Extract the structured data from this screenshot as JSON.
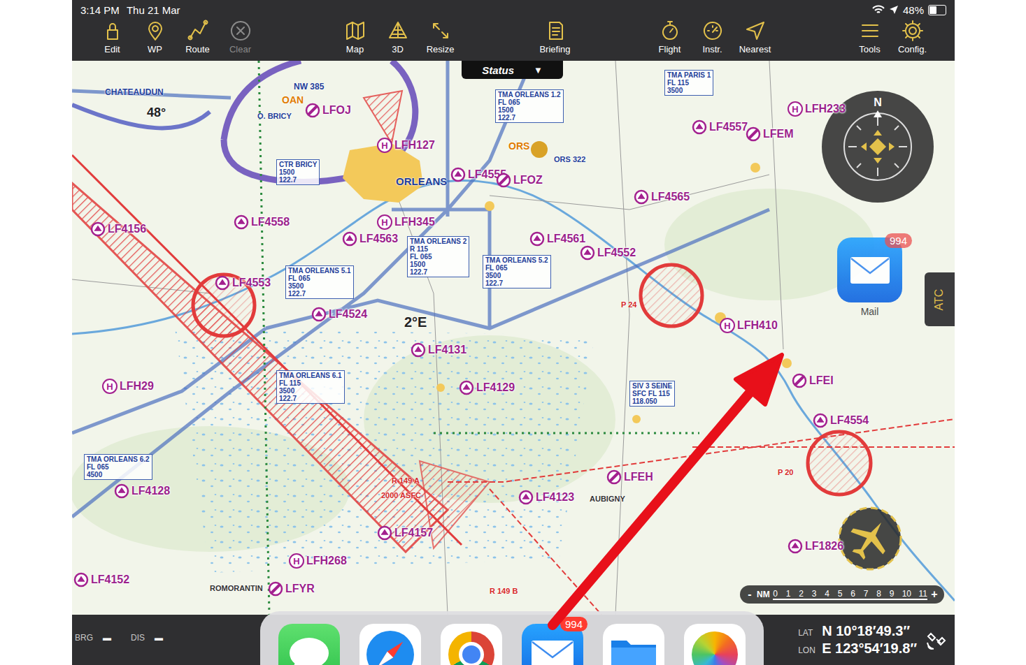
{
  "status_bar": {
    "time": "3:14 PM",
    "date": "Thu 21 Mar",
    "battery": "48%",
    "battery_level": 0.48
  },
  "toolbar": {
    "groups": [
      [
        {
          "label": "Edit",
          "disabled": false
        },
        {
          "label": "WP",
          "disabled": false
        },
        {
          "label": "Route",
          "disabled": false
        },
        {
          "label": "Clear",
          "disabled": true
        }
      ],
      [
        {
          "label": "Map",
          "disabled": false
        },
        {
          "label": "3D",
          "disabled": false
        },
        {
          "label": "Resize",
          "disabled": false
        }
      ],
      [
        {
          "label": "Briefing",
          "disabled": false
        }
      ],
      [
        {
          "label": "Flight",
          "disabled": false
        },
        {
          "label": "Instr.",
          "disabled": false
        },
        {
          "label": "Nearest",
          "disabled": false
        }
      ],
      [
        {
          "label": "Tools",
          "disabled": false
        },
        {
          "label": "Config.",
          "disabled": false
        }
      ]
    ]
  },
  "status_tab": {
    "label": "Status",
    "caret": "▼"
  },
  "map": {
    "airfields": [
      {
        "code": "LFH127",
        "kind": "heliport",
        "symbol": "H"
      },
      {
        "code": "LFOJ",
        "kind": "airport"
      },
      {
        "code": "LF4555",
        "kind": "airfield"
      },
      {
        "code": "LFOZ",
        "kind": "airport"
      },
      {
        "code": "LF4565",
        "kind": "airfield"
      },
      {
        "code": "LF4557",
        "kind": "airfield"
      },
      {
        "code": "LFEM",
        "kind": "airport"
      },
      {
        "code": "LFH233",
        "kind": "heliport",
        "symbol": "H"
      },
      {
        "code": "LF4156",
        "kind": "airfield"
      },
      {
        "code": "LF4558",
        "kind": "airfield"
      },
      {
        "code": "LFH345",
        "kind": "heliport",
        "symbol": "H"
      },
      {
        "code": "LF4563",
        "kind": "airfield"
      },
      {
        "code": "LF4561",
        "kind": "airfield"
      },
      {
        "code": "LF4552",
        "kind": "airfield"
      },
      {
        "code": "LF4553",
        "kind": "airfield"
      },
      {
        "code": "LF4524",
        "kind": "airfield"
      },
      {
        "code": "LFH410",
        "kind": "heliport",
        "symbol": "H"
      },
      {
        "code": "LF4131",
        "kind": "airfield"
      },
      {
        "code": "LF4129",
        "kind": "airfield"
      },
      {
        "code": "LFH29",
        "kind": "heliport",
        "symbol": "H"
      },
      {
        "code": "LFEI",
        "kind": "airport"
      },
      {
        "code": "LF4554",
        "kind": "airfield"
      },
      {
        "code": "LFEH",
        "kind": "airport"
      },
      {
        "code": "LF4128",
        "kind": "airfield"
      },
      {
        "code": "LF4123",
        "kind": "airfield"
      },
      {
        "code": "LF4157",
        "kind": "airfield"
      },
      {
        "code": "LFH268",
        "kind": "heliport",
        "symbol": "H"
      },
      {
        "code": "LF1826",
        "kind": "airfield"
      },
      {
        "code": "LF4152",
        "kind": "airfield"
      },
      {
        "code": "LFYR",
        "kind": "airport"
      }
    ],
    "zones": [
      {
        "lines": [
          "TMA ORLEANS 1.2",
          "FL 065",
          "1500",
          "122.7"
        ]
      },
      {
        "lines": [
          "TMA PARIS 1",
          "FL 115",
          "3500"
        ]
      },
      {
        "lines": [
          "CTR BRICY",
          "1500",
          "122.7"
        ]
      },
      {
        "lines": [
          "TMA ORLEANS 2",
          "R 115",
          "FL 065",
          "1500",
          "122.7"
        ]
      },
      {
        "lines": [
          "TMA ORLEANS 5.1",
          "FL 065",
          "3500",
          "122.7"
        ]
      },
      {
        "lines": [
          "TMA ORLEANS 5.2",
          "FL 065",
          "3500",
          "122.7"
        ]
      },
      {
        "lines": [
          "TMA ORLEANS 6.1",
          "FL 115",
          "3500",
          "122.7"
        ]
      },
      {
        "lines": [
          "TMA ORLEANS 6.2",
          "FL 065",
          "4500"
        ]
      },
      {
        "lines": [
          "SIV 3 SEINE",
          "SFC  FL 115",
          "118.050"
        ]
      }
    ],
    "places": [
      {
        "text": "ORLEANS",
        "color": "#1f3e9a"
      },
      {
        "text": "CHATEAUDUN",
        "color": "#1f3e9a"
      },
      {
        "text": "48°",
        "color": "#222222"
      },
      {
        "text": "O. BRICY",
        "color": "#1f3e9a"
      },
      {
        "text": "OAN",
        "color": "#e07b00"
      },
      {
        "text": "ORS",
        "color": "#e07b00"
      },
      {
        "text": "ORS 322",
        "color": "#1f3e9a"
      },
      {
        "text": "2°E",
        "color": "#222222"
      },
      {
        "text": "AUBIGNY",
        "color": "#333333"
      },
      {
        "text": "ROMORANTIN",
        "color": "#333333"
      },
      {
        "text": "P 24",
        "color": "#d62828"
      },
      {
        "text": "P 20",
        "color": "#d62828"
      },
      {
        "text": "R 149 A",
        "color": "#d62828"
      },
      {
        "text": "2000 ASFC",
        "color": "#d62828"
      },
      {
        "text": "R 149 B",
        "color": "#d62828"
      },
      {
        "text": "NW 385",
        "color": "#1f3e9a"
      }
    ]
  },
  "compass": {
    "north": "N"
  },
  "floating_mail": {
    "badge": "994",
    "label": "Mail"
  },
  "atc_tab": {
    "label": "ATC"
  },
  "scale": {
    "minus": "-",
    "unit": "NM",
    "ticks": [
      "0",
      "1",
      "2",
      "3",
      "4",
      "5",
      "6",
      "7",
      "8",
      "9",
      "10",
      "11"
    ],
    "plus": "+"
  },
  "bottom_bar": {
    "bearing": {
      "label": "BRG",
      "value": "▬"
    },
    "distance": {
      "label": "DIS",
      "value": "▬"
    },
    "lat": {
      "label": "LAT",
      "value": "N 10°18′49.3″"
    },
    "lon": {
      "label": "LON",
      "value": "E 123°54′19.8″"
    }
  },
  "dock": {
    "mail_badge": "994"
  }
}
